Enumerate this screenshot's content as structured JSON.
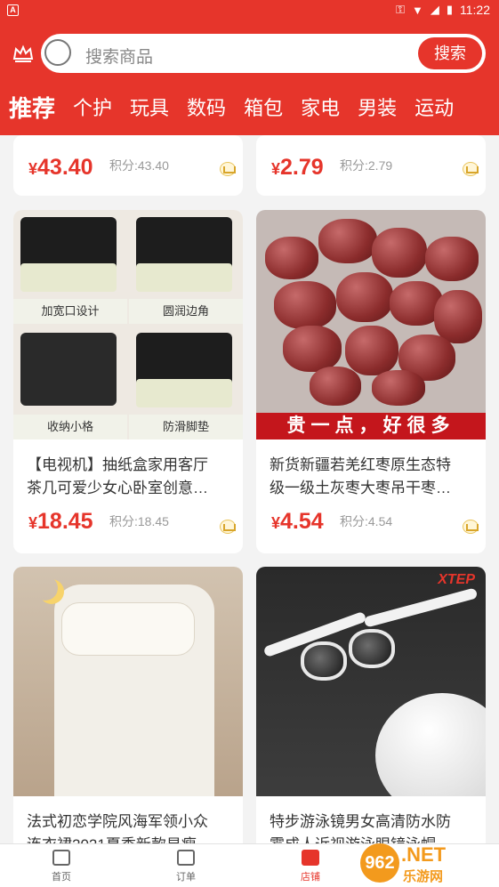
{
  "statusbar": {
    "time": "11:22"
  },
  "search": {
    "placeholder": "搜索商品",
    "button": "搜索"
  },
  "tabs": [
    "推荐",
    "个护",
    "玩具",
    "数码",
    "箱包",
    "家电",
    "男装",
    "运动"
  ],
  "products": [
    {
      "title": "",
      "price_symbol": "¥",
      "price": "43.40",
      "points": "积分:43.40"
    },
    {
      "title": "",
      "price_symbol": "¥",
      "price": "2.79",
      "points": "积分:2.79"
    },
    {
      "title_line1": "【电视机】抽纸盒家用客厅",
      "title_line2": "茶几可爱少女心卧室创意…",
      "price_symbol": "¥",
      "price": "18.45",
      "points": "积分:18.45",
      "image_labels": [
        "加宽口设计",
        "圆润边角",
        "收纳小格",
        "防滑脚垫"
      ]
    },
    {
      "title_line1": "新货新疆若羌红枣原生态特",
      "title_line2": "级一级土灰枣大枣吊干枣…",
      "price_symbol": "¥",
      "price": "4.54",
      "points": "积分:4.54",
      "image_banner": "贵一点，好很多"
    },
    {
      "title_line1": "法式初恋学院风海军领小众",
      "title_line2": "连衣裙2021夏季新款显瘦…"
    },
    {
      "title_line1": "特步游泳镜男女高清防水防",
      "title_line2": "雾成人近视游泳眼镜泳帽…",
      "image_brand": "XTEP"
    }
  ],
  "bottom_nav": [
    {
      "label": "首页",
      "icon": "home-icon"
    },
    {
      "label": "订单",
      "icon": "order-icon"
    },
    {
      "label": "店铺",
      "icon": "shop-icon"
    }
  ],
  "watermark": {
    "main": "962",
    "suffix": ".NET",
    "sub": "乐游网"
  },
  "colors": {
    "brand_red": "#e6352b",
    "price_red": "#e6352b",
    "watermark_orange": "#f39a1d"
  }
}
